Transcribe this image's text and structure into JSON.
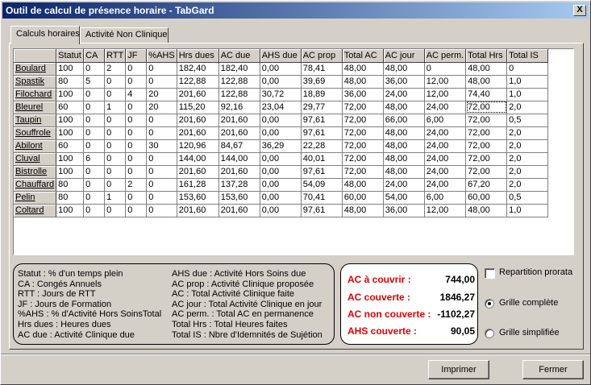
{
  "window": {
    "title": "Outil de calcul de présence horaire - TabGard",
    "close_label": "X"
  },
  "tabs": [
    {
      "label": "Calculs horaires",
      "active": true
    },
    {
      "label": "Activité Non Clinique",
      "active": false
    }
  ],
  "grid": {
    "columns": [
      "",
      "Statut",
      "CA",
      "RTT",
      "JF",
      "%AHS",
      "Hrs dues",
      "AC due",
      "AHS due",
      "AC prop",
      "Total AC",
      "AC jour",
      "AC perm.",
      "Total Hrs",
      "Total IS"
    ],
    "rows": [
      [
        "Boulard",
        "100",
        "0",
        "2",
        "0",
        "0",
        "182,40",
        "182,40",
        "0,00",
        "78,41",
        "48,00",
        "48,00",
        "0",
        "48,00",
        "0"
      ],
      [
        "Spastik",
        "80",
        "5",
        "0",
        "0",
        "0",
        "122,88",
        "122,88",
        "0,00",
        "39,69",
        "48,00",
        "36,00",
        "12,00",
        "48,00",
        "1,0"
      ],
      [
        "Filochard",
        "100",
        "0",
        "0",
        "4",
        "20",
        "201,60",
        "122,88",
        "30,72",
        "18,89",
        "36,00",
        "24,00",
        "12,00",
        "74,40",
        "1,0"
      ],
      [
        "Bleurel",
        "60",
        "0",
        "1",
        "0",
        "20",
        "115,20",
        "92,16",
        "23,04",
        "29,77",
        "72,00",
        "48,00",
        "24,00",
        "72,00",
        "2,0"
      ],
      [
        "Taupin",
        "100",
        "0",
        "0",
        "0",
        "0",
        "201,60",
        "201,60",
        "0,00",
        "97,61",
        "72,00",
        "66,00",
        "6,00",
        "72,00",
        "0,5"
      ],
      [
        "Souffrole",
        "100",
        "0",
        "0",
        "0",
        "0",
        "201,60",
        "201,60",
        "0,00",
        "97,61",
        "72,00",
        "48,00",
        "24,00",
        "72,00",
        "2,0"
      ],
      [
        "Abilont",
        "60",
        "0",
        "0",
        "0",
        "30",
        "120,96",
        "84,67",
        "36,29",
        "22,28",
        "72,00",
        "48,00",
        "24,00",
        "72,00",
        "2,0"
      ],
      [
        "Cluval",
        "100",
        "6",
        "0",
        "0",
        "0",
        "144,00",
        "144,00",
        "0,00",
        "40,01",
        "72,00",
        "48,00",
        "24,00",
        "72,00",
        "2,0"
      ],
      [
        "Bistrolle",
        "100",
        "0",
        "0",
        "0",
        "0",
        "201,60",
        "201,60",
        "0,00",
        "97,61",
        "72,00",
        "48,00",
        "24,00",
        "72,00",
        "2,0"
      ],
      [
        "Chauffard",
        "80",
        "0",
        "0",
        "2",
        "0",
        "161,28",
        "137,28",
        "0,00",
        "54,09",
        "48,00",
        "24,00",
        "24,00",
        "67,20",
        "2,0"
      ],
      [
        "Pelin",
        "80",
        "0",
        "1",
        "0",
        "0",
        "153,60",
        "153,60",
        "0,00",
        "70,41",
        "60,00",
        "54,00",
        "6,00",
        "60,00",
        "0,5"
      ],
      [
        "Coltard",
        "100",
        "0",
        "0",
        "0",
        "0",
        "201,60",
        "201,60",
        "0,00",
        "97,61",
        "48,00",
        "36,00",
        "12,00",
        "48,00",
        "1,0"
      ]
    ]
  },
  "legend": {
    "left": [
      "Statut : % d'un temps plein",
      "CA : Congés Annuels",
      "RTT : Jours de RTT",
      "JF : Jours de Formation",
      "%AHS : % d'Activité Hors SoinsTotal",
      "Hrs dues : Heures dues",
      "AC due : Activité Clinique due"
    ],
    "right": [
      "AHS due : Activité Hors Soins due",
      "AC prop : Activité Clinique proposée",
      "AC : Total  Activité Clinique faite",
      "AC jour : Total Activité Clinique en jour",
      "AC perm. : Total AC en permanence",
      "Total Hrs : Total Heures faites",
      "Total IS : Nbre d'Idemnités de Sujétion"
    ]
  },
  "summary": [
    {
      "label": "AC à couvrir :",
      "value": "744,00"
    },
    {
      "label": "AC couverte :",
      "value": "1846,27"
    },
    {
      "label": "AC non couverte :",
      "value": "-1102,27"
    },
    {
      "label": "AHS couverte :",
      "value": "90,05"
    }
  ],
  "options": {
    "repartition_label": "Repartition prorata",
    "grille_complete_label": "Grille complète",
    "grille_simplifiee_label": "Grille simplifiée",
    "selected": "Grille complète"
  },
  "buttons": {
    "print_label": "Imprimer",
    "close_label": "Fermer"
  },
  "colors": {
    "titlebar_start": "#0a246a",
    "titlebar_end": "#a6caf0",
    "summary_label": "#e00000",
    "face": "#d4d0c8"
  }
}
